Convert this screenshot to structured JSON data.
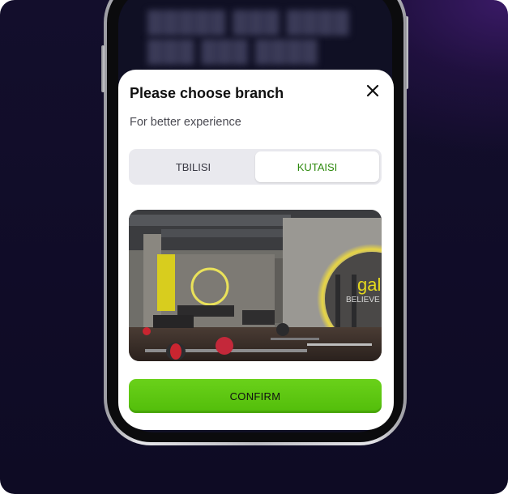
{
  "modal": {
    "title": "Please choose branch",
    "subtitle": "For better experience",
    "close_icon": "close-icon"
  },
  "branches": {
    "options": [
      "TBILISI",
      "KUTAISI"
    ],
    "selected": "KUTAISI"
  },
  "photo": {
    "sign_text": "gal",
    "wall_text": "BELIEVE"
  },
  "confirm": {
    "label": "CONFIRM"
  },
  "colors": {
    "accent_green": "#58c30e",
    "selected_text": "#2f8a0f",
    "background": "#0e0b24"
  }
}
